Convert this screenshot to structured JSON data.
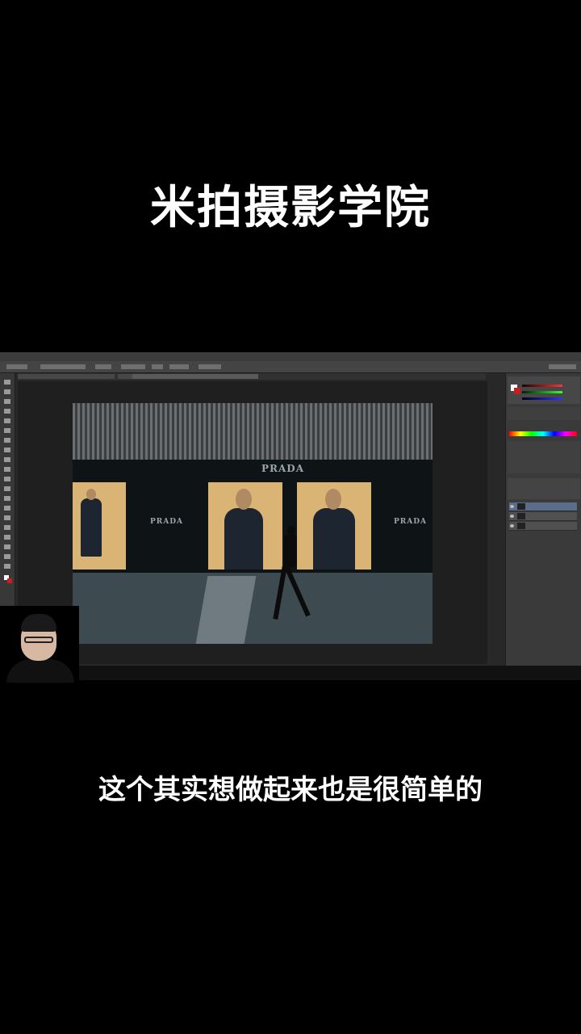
{
  "overlay": {
    "title": "米拍摄影学院",
    "subtitle": "这个其实想做起来也是很简单的"
  },
  "photo": {
    "brand_top": "PRADA",
    "brand_left": "PRADA",
    "brand_right": "PRADA"
  },
  "colors": {
    "background": "#000000",
    "ps_ui": "#282828",
    "ps_panel": "#3a3a3a",
    "window_light": "#d9b474",
    "selected_layer": "#5a6e8c"
  },
  "icons": {
    "layer_visibility": "eye-icon",
    "color_swatch": "swatch-icon"
  }
}
